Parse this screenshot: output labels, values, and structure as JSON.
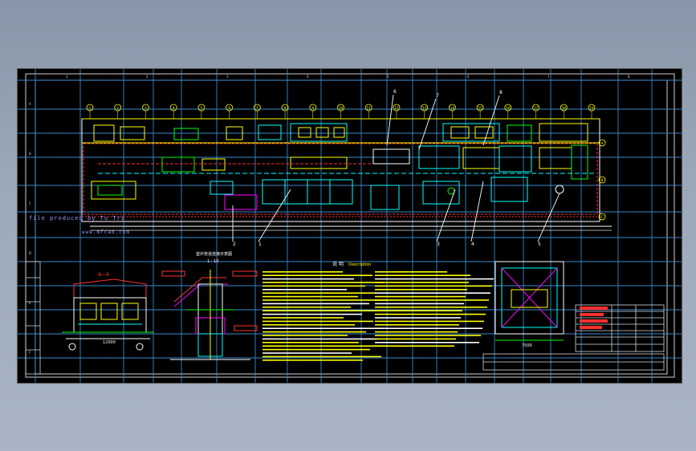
{
  "drawing": {
    "watermark_line1": "file produced by Tu Tri",
    "watermark_line2": "www.mfcad.com",
    "section_title": "A—A",
    "detail_title": "室外管道连接示意图",
    "detail_scale": "1 : 10",
    "notes_heading": "说 明",
    "notes_heading_en": "Description",
    "grid_top_labels": [
      "1",
      "2",
      "3",
      "4",
      "5",
      "6",
      "7",
      "8",
      "9",
      "10",
      "11",
      "12",
      "13",
      "14",
      "15",
      "16",
      "17",
      "18",
      "19"
    ],
    "grid_side_labels": [
      "A",
      "B",
      "C"
    ],
    "callouts": [
      "1",
      "2",
      "3",
      "4",
      "5",
      "6",
      "7",
      "8"
    ],
    "section_dim": "12000",
    "plan_dim": "7500",
    "frame_top_numbers": [
      "1",
      "2",
      "3",
      "4",
      "5",
      "6",
      "7",
      "8"
    ],
    "frame_side_letters": [
      "A",
      "B",
      "C",
      "D",
      "E",
      "F"
    ],
    "title_block_rows": [
      "",
      "",
      "",
      "",
      "",
      ""
    ]
  },
  "colors": {
    "background": "#000000",
    "grid": "#3f8fd6",
    "frame": "#d9d9d9",
    "yellow": "#ffff00",
    "cyan": "#00ffff",
    "green": "#00ff00",
    "red": "#ff3030",
    "magenta": "#ff00ff",
    "white": "#ffffff"
  }
}
